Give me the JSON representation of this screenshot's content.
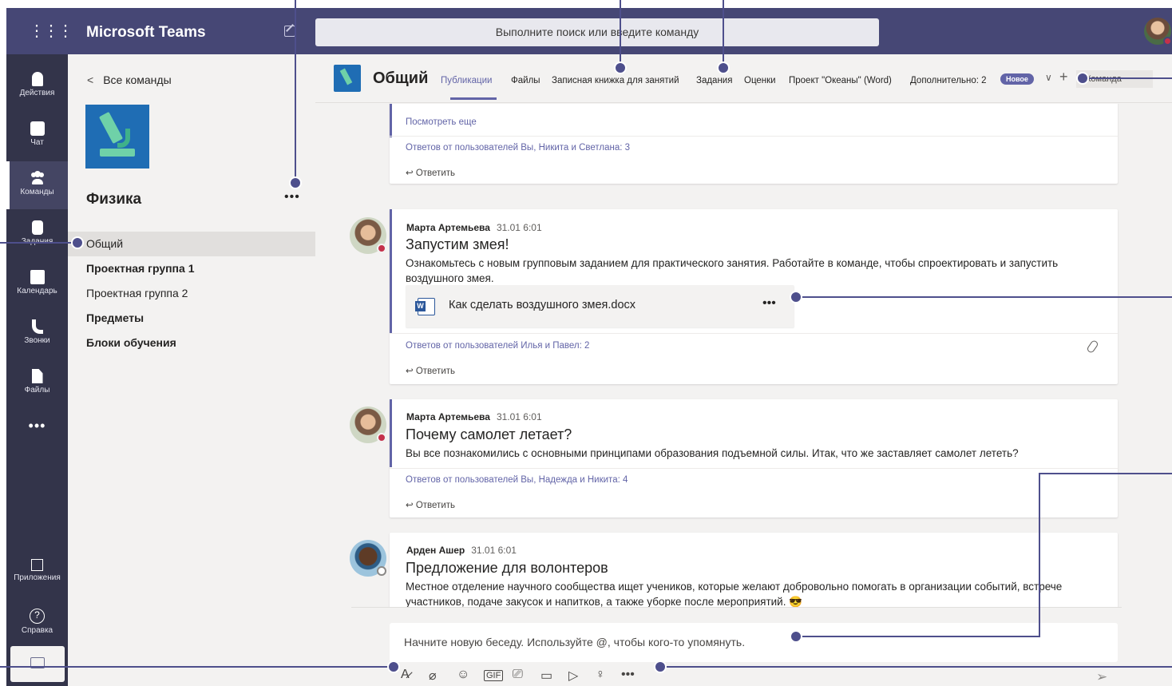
{
  "topbar": {
    "app_title": "Microsoft Teams",
    "search_placeholder": "Выполните поиск или введите команду"
  },
  "rail": {
    "items": [
      {
        "label": "Действия",
        "icon": "bell-icon"
      },
      {
        "label": "Чат",
        "icon": "chat-icon"
      },
      {
        "label": "Команды",
        "icon": "teams-icon"
      },
      {
        "label": "Задания",
        "icon": "assignments-icon"
      },
      {
        "label": "Календарь",
        "icon": "calendar-icon"
      },
      {
        "label": "Звонки",
        "icon": "phone-icon"
      },
      {
        "label": "Файлы",
        "icon": "files-icon"
      }
    ],
    "more": "•••",
    "bottom": [
      {
        "label": "Приложения",
        "icon": "apps-icon"
      },
      {
        "label": "Справка",
        "icon": "help-icon"
      }
    ]
  },
  "teampanel": {
    "back_label": "Все команды",
    "team_name": "Физика",
    "more": "•••",
    "channels": [
      {
        "label": "Общий",
        "bold": false,
        "selected": true
      },
      {
        "label": "Проектная группа 1",
        "bold": true,
        "selected": false
      },
      {
        "label": "Проектная группа 2",
        "bold": false,
        "selected": false
      },
      {
        "label": "Предметы",
        "bold": true,
        "selected": false
      },
      {
        "label": "Блоки обучения",
        "bold": true,
        "selected": false
      }
    ]
  },
  "channel_header": {
    "title": "Общий",
    "tabs": [
      "Публикации",
      "Файлы",
      "Записная книжка для занятий",
      "Задания",
      "Оценки",
      "Проект \"Океаны\" (Word)",
      "Дополнительно: 2"
    ],
    "badge": "Новое",
    "team_button": "Команда"
  },
  "posts": [
    {
      "see_more": "Посмотреть еще",
      "replies": "Ответов от пользователей Вы, Никита и Светлана: 3",
      "reply": "Ответить"
    },
    {
      "author": "Марта Артемьева",
      "time": "31.01 6:01",
      "subject": "Запустим змея!",
      "body": "Ознакомьтесь с новым групповым заданием для практического занятия. Работайте в команде, чтобы спроектировать и запустить воздушного змея.",
      "attachment": "Как сделать воздушного змея.docx",
      "attachment_more": "•••",
      "replies": "Ответов от пользователей Илья и Павел: 2",
      "reply": "Ответить"
    },
    {
      "author": "Марта Артемьева",
      "time": "31.01 6:01",
      "subject": "Почему самолет летает?",
      "body": "Вы все познакомились с основными принципами образования подъемной силы. Итак, что же заставляет самолет лететь?",
      "replies": "Ответов от пользователей Вы, Надежда и Никита: 4",
      "reply": "Ответить"
    },
    {
      "author": "Арден Ашер",
      "time": "31.01 6:01",
      "subject": "Предложение для волонтеров",
      "body": "Местное отделение научного сообщества ищет учеников, которые желают добровольно помогать в организации событий, встрече участников, подаче закусок и напитков, а также уборке после мероприятий. 😎"
    }
  ],
  "compose": {
    "placeholder": "Начните новую беседу. Используйте @, чтобы кого-то упомянуть.",
    "more": "•••"
  },
  "colors": {
    "topbar": "#464775",
    "rail": "#33344a",
    "accent": "#6264a7",
    "annotation": "#4e4f8c"
  }
}
